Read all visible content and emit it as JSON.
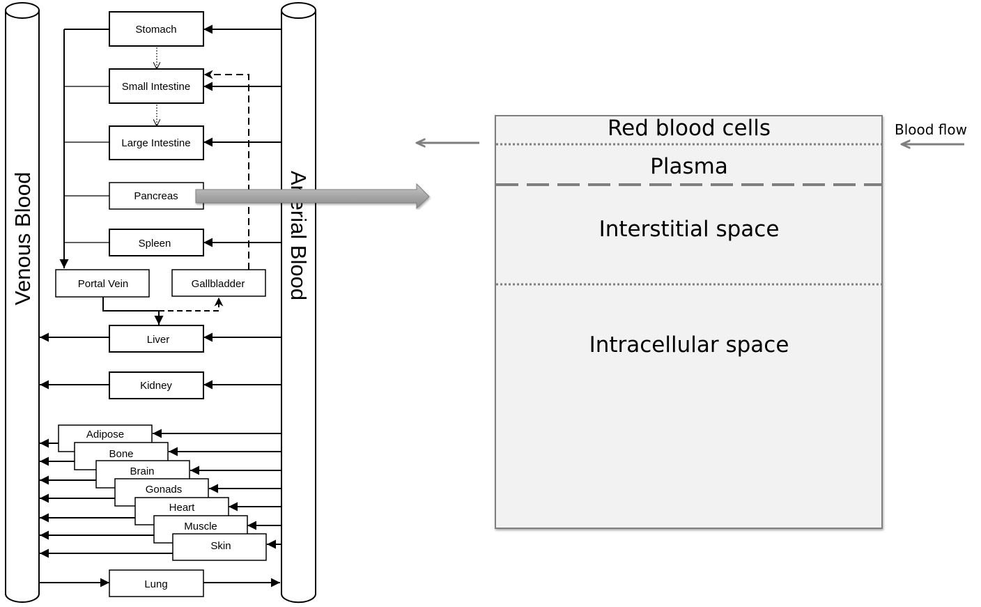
{
  "vessels": {
    "venous": "Venous Blood",
    "arterial": "Arterial Blood"
  },
  "organs": {
    "stomach": "Stomach",
    "small_intestine": "Small Intestine",
    "large_intestine": "Large Intestine",
    "pancreas": "Pancreas",
    "spleen": "Spleen",
    "portal_vein": "Portal Vein",
    "gallbladder": "Gallbladder",
    "liver": "Liver",
    "kidney": "Kidney",
    "adipose": "Adipose",
    "bone": "Bone",
    "brain": "Brain",
    "gonads": "Gonads",
    "heart": "Heart",
    "muscle": "Muscle",
    "skin": "Skin",
    "lung": "Lung"
  },
  "compartment": {
    "red_blood_cells": "Red blood cells",
    "plasma": "Plasma",
    "interstitial": "Interstitial space",
    "intracellular": "Intracellular space",
    "blood_flow": "Blood flow"
  },
  "colors": {
    "line": "#000000",
    "compartment_fill": "#f2f2f2",
    "compartment_border": "#7f7f7f",
    "expand_arrow": "#a6a6a6"
  }
}
